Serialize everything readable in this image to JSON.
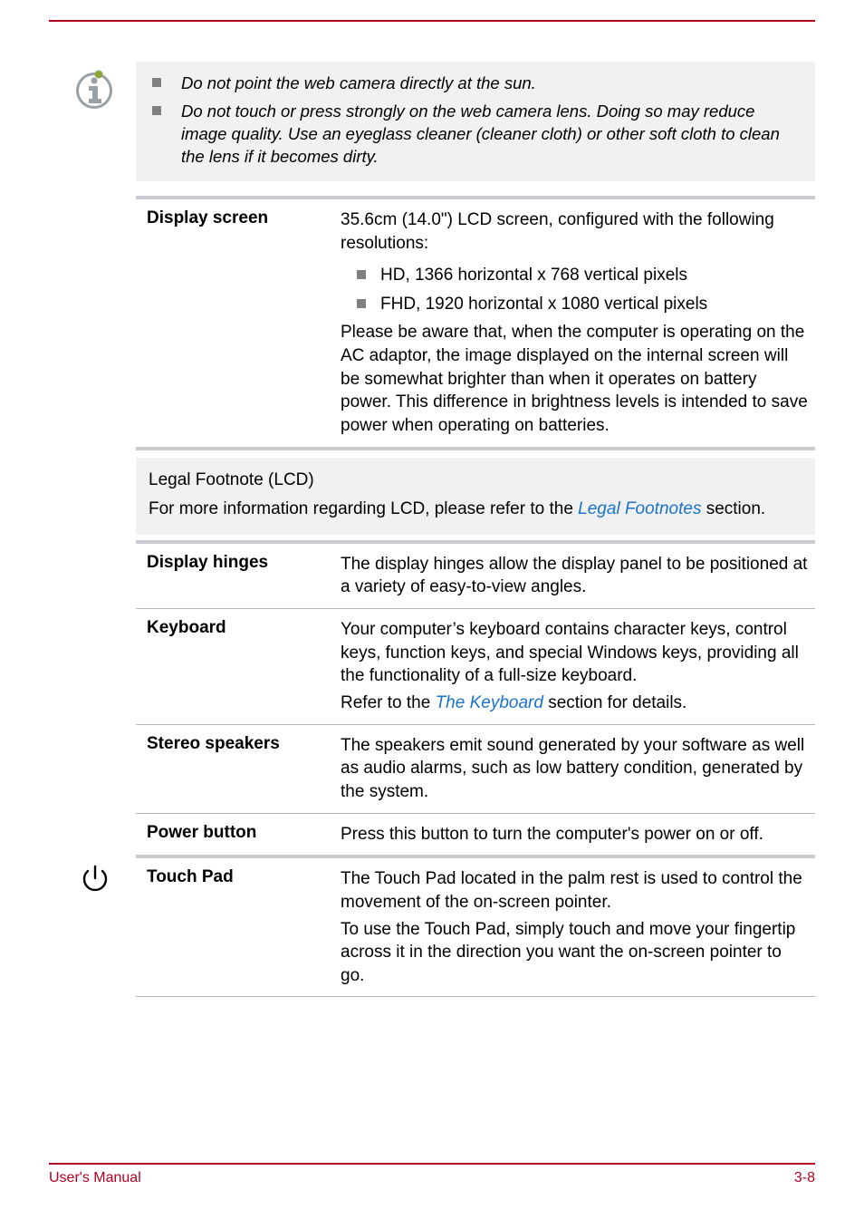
{
  "note": {
    "items": [
      "Do not point the web camera directly at the sun.",
      "Do not touch or press strongly on the web camera lens. Doing so may reduce image quality. Use an eyeglass cleaner (cleaner cloth) or other soft cloth to clean the lens if it becomes dirty."
    ]
  },
  "display_screen": {
    "label": "Display screen",
    "intro": "35.6cm (14.0\") LCD screen, configured with the following resolutions:",
    "bullets": [
      "HD, 1366 horizontal x 768 vertical pixels",
      "FHD, 1920 horizontal x 1080 vertical pixels"
    ],
    "note": "Please be aware that, when the computer is operating on the AC adaptor, the image displayed on the internal screen will be somewhat brighter than when it operates on battery power. This difference in brightness levels is intended to save power when operating on batteries."
  },
  "legal": {
    "heading": "Legal Footnote (LCD)",
    "pre": "For more information regarding LCD, please refer to the ",
    "link": "Legal Footnotes",
    "post": " section."
  },
  "rows": {
    "display_hinges": {
      "label": "Display hinges",
      "text": "The display hinges allow the display panel to be positioned at a variety of easy-to-view angles."
    },
    "keyboard": {
      "label": "Keyboard",
      "text": "Your computer’s keyboard contains character keys, control keys, function keys, and special Windows keys, providing all the functionality of a full-size keyboard.",
      "ref_pre": "Refer to the ",
      "ref_link": "The Keyboard",
      "ref_post": " section for details."
    },
    "stereo": {
      "label": "Stereo speakers",
      "text": "The speakers emit sound generated by your software as well as audio alarms, such as low battery condition, generated by the system."
    },
    "power": {
      "label": "Power button",
      "text": "Press this button to turn the computer's power on or off."
    },
    "touchpad": {
      "label": "Touch Pad",
      "text1": "The Touch Pad located in the palm rest is used to control the movement of the on-screen pointer.",
      "text2": "To use the Touch Pad, simply touch and move your fingertip across it in the direction you want the on-screen pointer to go."
    }
  },
  "footer": {
    "left": "User's Manual",
    "right": "3-8"
  }
}
